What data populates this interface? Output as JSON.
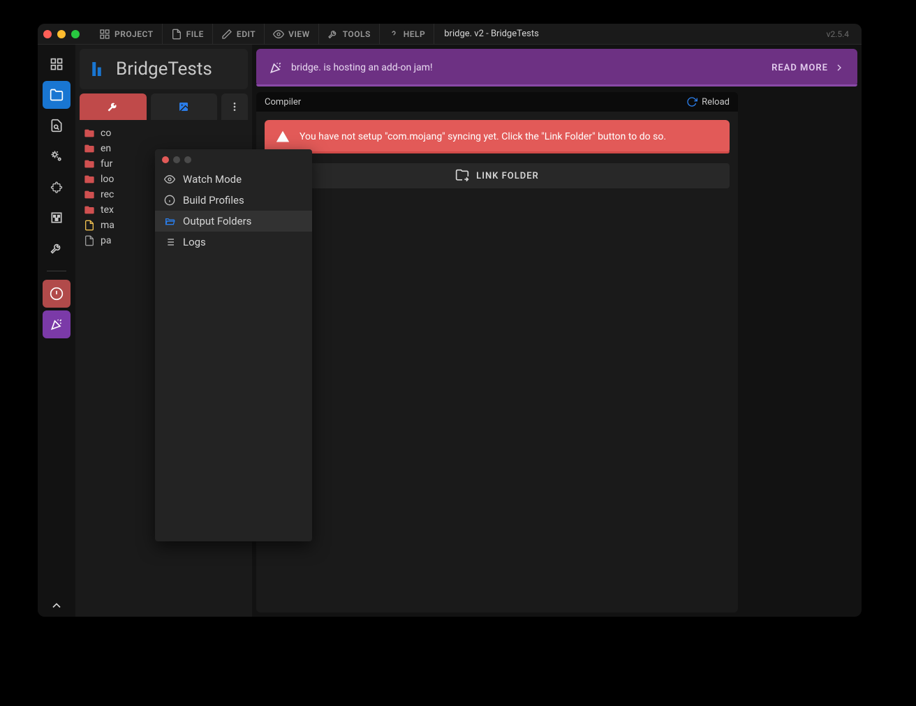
{
  "menubar": {
    "project": "PROJECT",
    "file": "FILE",
    "edit": "EDIT",
    "view": "VIEW",
    "tools": "TOOLS",
    "help": "HELP"
  },
  "window_title": "bridge. v2 - BridgeTests",
  "version": "v2.5.4",
  "project": {
    "title": "BridgeTests"
  },
  "file_tree": [
    {
      "name": "co",
      "type": "folder"
    },
    {
      "name": "en",
      "type": "folder"
    },
    {
      "name": "fur",
      "type": "folder"
    },
    {
      "name": "loo",
      "type": "folder"
    },
    {
      "name": "rec",
      "type": "folder"
    },
    {
      "name": "tex",
      "type": "folder"
    },
    {
      "name": "ma",
      "type": "file-json"
    },
    {
      "name": "pa",
      "type": "file-txt"
    }
  ],
  "popup": {
    "items": [
      {
        "label": "Watch Mode",
        "icon": "eye"
      },
      {
        "label": "Build Profiles",
        "icon": "info"
      },
      {
        "label": "Output Folders",
        "icon": "folder-open",
        "active": true
      },
      {
        "label": "Logs",
        "icon": "list"
      }
    ]
  },
  "banner": {
    "text": "bridge. is hosting an add-on jam!",
    "read_more": "READ MORE"
  },
  "compiler": {
    "title": "Compiler",
    "reload": "Reload",
    "alert": "You have not setup \"com.mojang\" syncing yet. Click the \"Link Folder\" button to do so.",
    "link_folder": "LINK FOLDER"
  }
}
